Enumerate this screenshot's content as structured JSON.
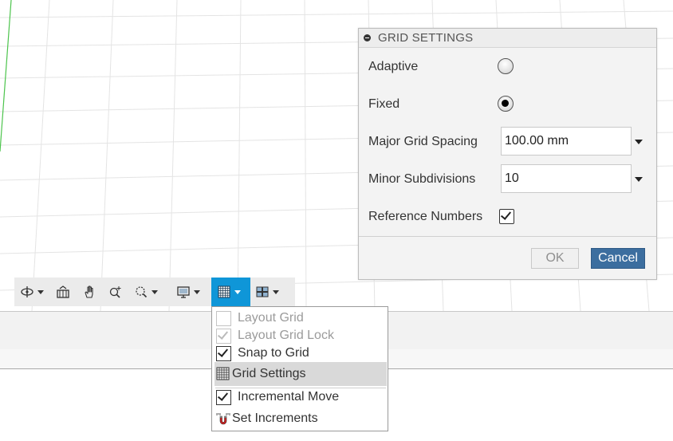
{
  "dialog": {
    "title": "GRID SETTINGS",
    "adaptive_label": "Adaptive",
    "adaptive_selected": false,
    "fixed_label": "Fixed",
    "fixed_selected": true,
    "major_label": "Major Grid Spacing",
    "major_value": "100.00 mm",
    "minor_label": "Minor Subdivisions",
    "minor_value": "10",
    "refnum_label": "Reference Numbers",
    "refnum_checked": true,
    "ok_label": "OK",
    "cancel_label": "Cancel"
  },
  "toolbar": {
    "icons": [
      "orbit-icon",
      "look-at-icon",
      "pan-hand-icon",
      "zoom-icon",
      "fit-zoom-icon",
      "display-settings-icon",
      "grid-snaps-icon",
      "viewports-icon"
    ],
    "active_tool": "grid-snaps-icon",
    "active_color": "#0f96d8"
  },
  "menu": {
    "items": [
      {
        "label": "Layout Grid",
        "checked": false,
        "enabled": false
      },
      {
        "label": "Layout Grid Lock",
        "checked": true,
        "enabled": false
      },
      {
        "label": "Snap to Grid",
        "checked": true,
        "enabled": true
      },
      {
        "label": "Grid Settings",
        "icon": "grid-icon",
        "highlighted": true
      },
      {
        "label": "Incremental Move",
        "checked": true,
        "enabled": true
      },
      {
        "label": "Set Increments",
        "icon": "magnet-icon"
      }
    ]
  },
  "colors": {
    "cancel_button": "#3c6e9f",
    "axis_line": "#4cc44c"
  }
}
